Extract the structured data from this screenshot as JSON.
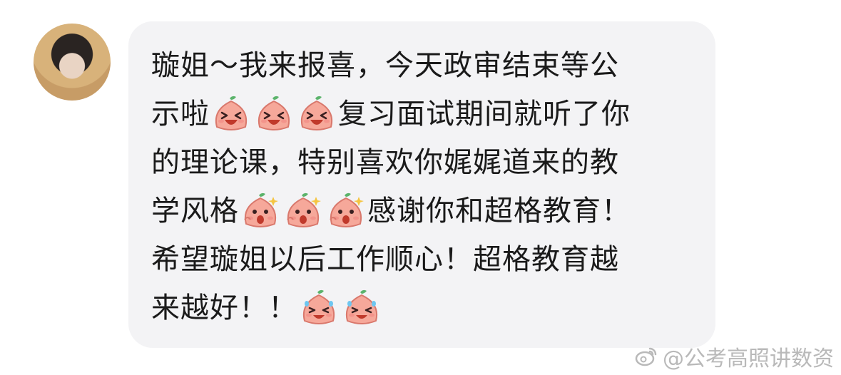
{
  "message": {
    "lines": [
      [
        {
          "t": "text",
          "v": "璇姐～我来报喜，今天政审结束等公"
        }
      ],
      [
        {
          "t": "text",
          "v": "示啦"
        },
        {
          "t": "emoji",
          "v": "laughing-peach-emoji"
        },
        {
          "t": "emoji",
          "v": "laughing-peach-emoji"
        },
        {
          "t": "emoji",
          "v": "laughing-peach-emoji"
        },
        {
          "t": "text",
          "v": "复习面试期间就听了你"
        }
      ],
      [
        {
          "t": "text",
          "v": "的理论课，特别喜欢你娓娓道来的教"
        }
      ],
      [
        {
          "t": "text",
          "v": "学风格"
        },
        {
          "t": "emoji",
          "v": "amazed-peach-emoji"
        },
        {
          "t": "emoji",
          "v": "amazed-peach-emoji"
        },
        {
          "t": "emoji",
          "v": "amazed-peach-emoji"
        },
        {
          "t": "text",
          "v": "感谢你和超格教育！"
        }
      ],
      [
        {
          "t": "text",
          "v": "希望璇姐以后工作顺心！超格教育越"
        }
      ],
      [
        {
          "t": "text",
          "v": "来越好！！"
        },
        {
          "t": "emoji",
          "v": "crying-laugh-peach-emoji"
        },
        {
          "t": "emoji",
          "v": "crying-laugh-peach-emoji"
        }
      ]
    ]
  },
  "watermark": {
    "text": "@公考高照讲数资",
    "icon": "weibo-icon"
  },
  "colors": {
    "bubble": "#f3f3f5",
    "text": "#1a1a1a",
    "watermark": "#b9b9b9"
  }
}
